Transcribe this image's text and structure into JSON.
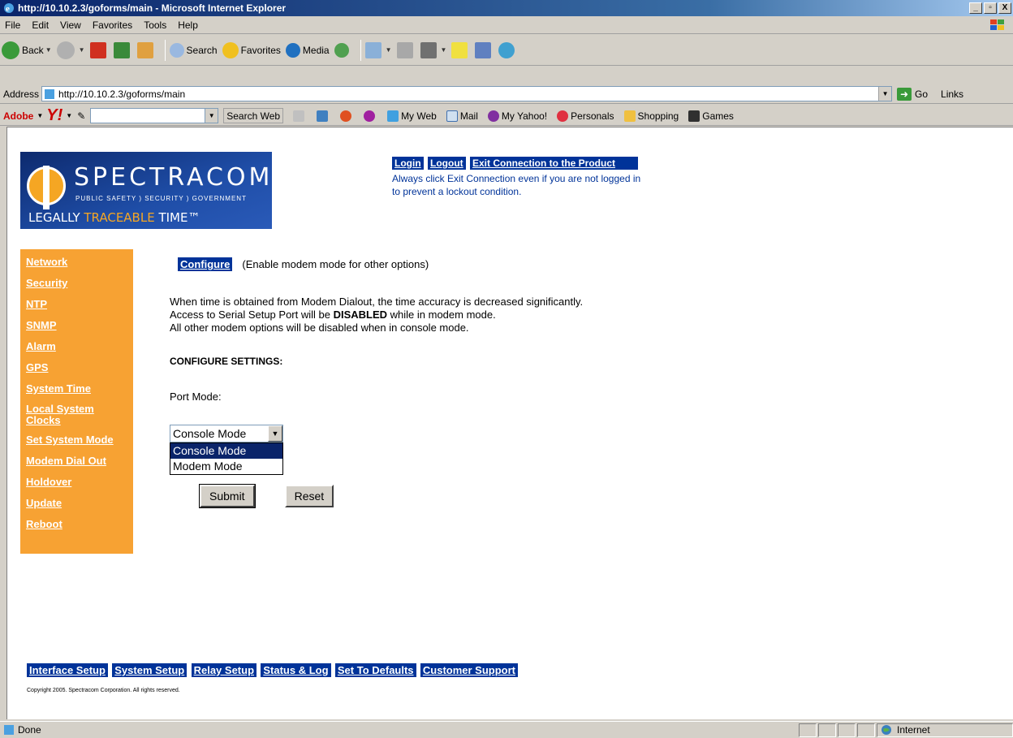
{
  "window": {
    "title": "http://10.10.2.3/goforms/main - Microsoft Internet Explorer",
    "controls": [
      "_",
      "▫",
      "X"
    ]
  },
  "menu": [
    "File",
    "Edit",
    "View",
    "Favorites",
    "Tools",
    "Help"
  ],
  "toolbar": {
    "back": "Back",
    "search": "Search",
    "favorites": "Favorites",
    "media": "Media"
  },
  "address": {
    "label": "Address",
    "url": "http://10.10.2.3/goforms/main",
    "go": "Go",
    "links": "Links"
  },
  "ytoolbar": {
    "adobe": "Adobe",
    "yahoo": "Y!",
    "search_web": "Search Web",
    "my_web": "My Web",
    "mail": "Mail",
    "my_yahoo": "My Yahoo!",
    "personals": "Personals",
    "shopping": "Shopping",
    "games": "Games"
  },
  "logo": {
    "brand": "SPECTRACOM",
    "tagline": "PUBLIC SAFETY ) SECURITY ) GOVERNMENT",
    "slogan_a": "LEGALLY ",
    "slogan_b": "TRACEABLE",
    "slogan_c": " TIME™"
  },
  "toplinks": {
    "login": "Login",
    "logout": "Logout",
    "exit": "Exit Connection to the Product",
    "note_1": "Always click Exit Connection even if you are not logged in",
    "note_2": "to prevent a lockout condition."
  },
  "sidebar": [
    "Network",
    "Security",
    "NTP",
    "SNMP",
    "Alarm",
    "GPS",
    "System Time",
    "Local System Clocks",
    "Set System Mode",
    "Modem Dial Out",
    "Holdover",
    "Update",
    "Reboot"
  ],
  "main": {
    "configure_link": "Configure",
    "configure_note": "(Enable modem mode for other options)",
    "line1": "When time is obtained from Modem Dialout, the time accuracy is decreased significantly.",
    "line2_a": "Access to Serial Setup Port will be ",
    "line2_b": "DISABLED",
    "line2_c": " while in modem mode.",
    "line3": "All other modem options will be disabled when in console mode.",
    "heading": "CONFIGURE SETTINGS:",
    "port_mode_label": "Port Mode:",
    "selected": "Console Mode",
    "options": [
      "Console Mode",
      "Modem Mode"
    ],
    "submit": "Submit",
    "reset": "Reset"
  },
  "bottomlinks": [
    "Interface Setup",
    "System Setup",
    "Relay Setup",
    "Status & Log",
    "Set To Defaults",
    "Customer Support"
  ],
  "copyright": "Copyright 2005. Spectracom Corporation. All rights reserved.",
  "status": {
    "done": "Done",
    "zone": "Internet"
  },
  "colors": {
    "sidebar": "#f7a233",
    "navlink": "#003399",
    "selection": "#0a246a"
  }
}
